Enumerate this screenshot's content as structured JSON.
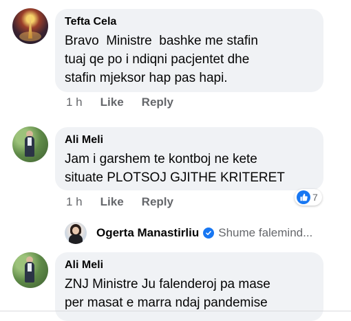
{
  "comments": [
    {
      "author": "Tefta Cela",
      "text": "Bravo  Ministre  bashke me stafin\ntuaj qe po i ndiqni pacjentet dhe\nstafin mjeksor hap pas hapi.",
      "time": "1 h",
      "like_label": "Like",
      "reply_label": "Reply"
    },
    {
      "author": "Ali Meli",
      "text": "Jam i garshem te kontboj ne kete\nsituate PLOTSOJ GJITHE KRITERET",
      "time": "1 h",
      "like_label": "Like",
      "reply_label": "Reply",
      "reaction_count": "7",
      "reaction_icon": "thumbs-up-icon",
      "reply_preview": {
        "author": "Ogerta Manastirliu",
        "verified_icon": "verified-badge-icon",
        "text": "Shume falemind..."
      }
    },
    {
      "author": "Ali Meli",
      "text": "ZNJ Ministre Ju falenderoj pa mase\nper masat e marra ndaj pandemise"
    }
  ],
  "colors": {
    "bubble": "#f0f2f5",
    "meta_text": "#65676b",
    "accent": "#1877f2"
  }
}
